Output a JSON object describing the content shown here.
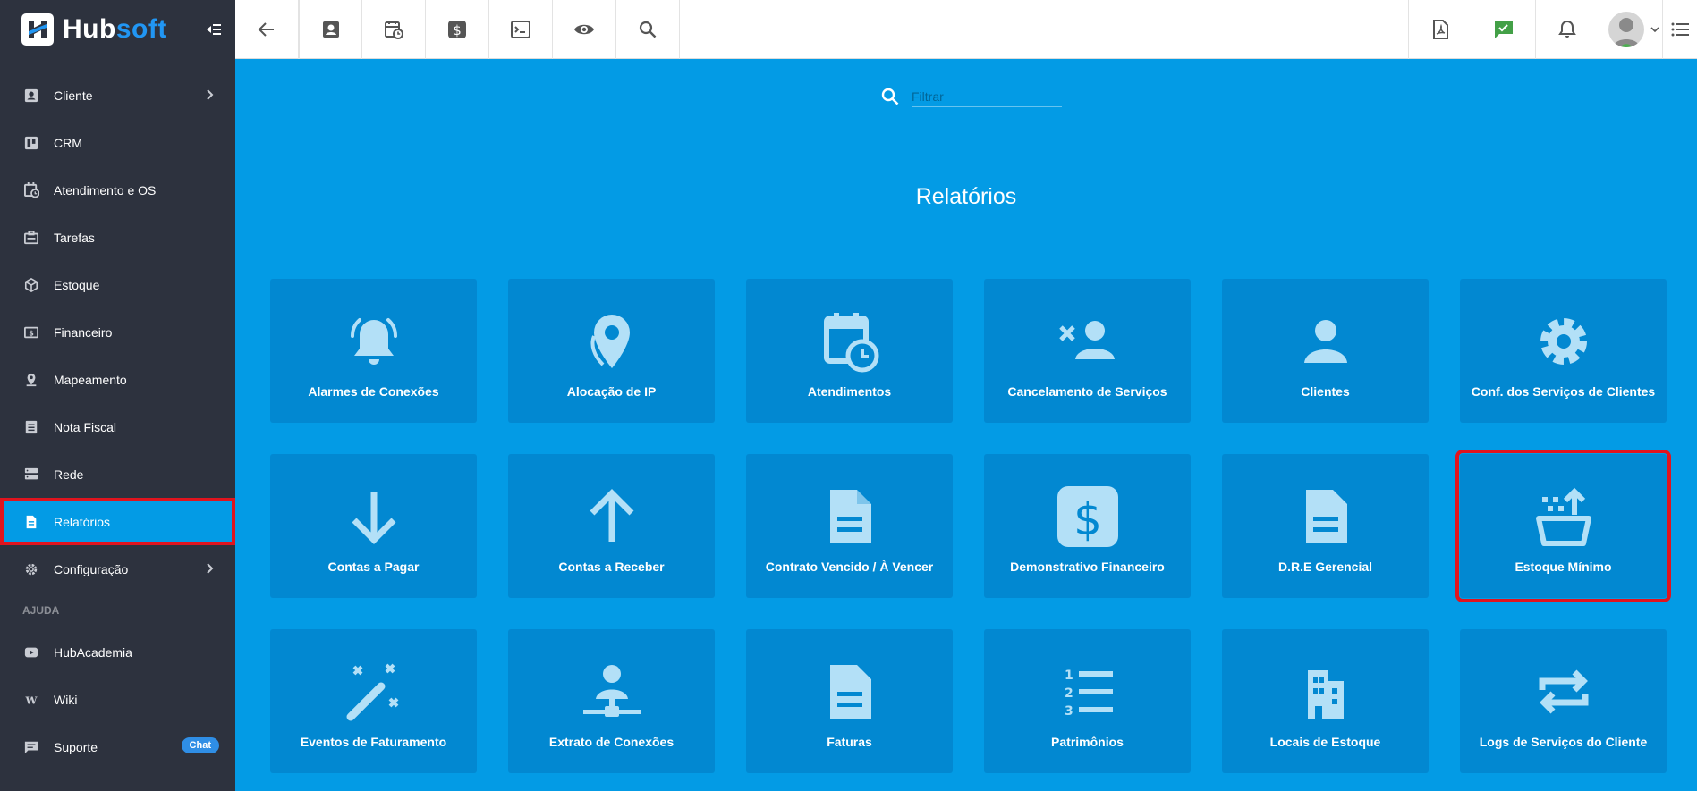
{
  "brand": {
    "name_part1": "Hub",
    "name_part2": "soft"
  },
  "sidebar": {
    "items": [
      {
        "label": "Cliente",
        "icon": "contact-card-icon",
        "has_submenu": true
      },
      {
        "label": "CRM",
        "icon": "kanban-icon",
        "has_submenu": false
      },
      {
        "label": "Atendimento e OS",
        "icon": "calendar-clock-icon",
        "has_submenu": false
      },
      {
        "label": "Tarefas",
        "icon": "tasks-icon",
        "has_submenu": false
      },
      {
        "label": "Estoque",
        "icon": "box-icon",
        "has_submenu": false
      },
      {
        "label": "Financeiro",
        "icon": "money-icon",
        "has_submenu": false
      },
      {
        "label": "Mapeamento",
        "icon": "map-pin-icon",
        "has_submenu": false
      },
      {
        "label": "Nota Fiscal",
        "icon": "receipt-icon",
        "has_submenu": false
      },
      {
        "label": "Rede",
        "icon": "server-icon",
        "has_submenu": false
      },
      {
        "label": "Relatórios",
        "icon": "document-icon",
        "has_submenu": false,
        "active": true
      },
      {
        "label": "Configuração",
        "icon": "gear-icon",
        "has_submenu": true
      }
    ],
    "help_section_label": "AJUDA",
    "help_items": [
      {
        "label": "HubAcademia",
        "icon": "youtube-icon"
      },
      {
        "label": "Wiki",
        "icon": "wikipedia-icon"
      },
      {
        "label": "Suporte",
        "icon": "chat-icon",
        "badge": "Chat"
      }
    ]
  },
  "toolbar": {
    "left_icons": [
      "back-arrow-icon",
      "contact-card-icon",
      "calendar-clock-icon",
      "dollar-icon",
      "terminal-icon",
      "eye-icon",
      "search-icon"
    ],
    "right_icons": [
      "pdf-icon",
      "check-message-icon",
      "bell-icon",
      "avatar",
      "menu-list-icon"
    ],
    "check_color": "#43a047"
  },
  "main": {
    "filter_placeholder": "Filtrar",
    "title": "Relatórios",
    "accent_color": "#039be5",
    "card_color": "#0288d1",
    "highlight_color": "#e0141e",
    "cards": [
      {
        "label": "Alarmes de Conexões",
        "icon": "bell-ringing-icon"
      },
      {
        "label": "Alocação de IP",
        "icon": "map-pin-icon"
      },
      {
        "label": "Atendimentos",
        "icon": "calendar-clock-icon"
      },
      {
        "label": "Cancelamento de Serviços",
        "icon": "person-remove-icon"
      },
      {
        "label": "Clientes",
        "icon": "person-icon"
      },
      {
        "label": "Conf. dos Serviços de Clientes",
        "icon": "gear-icon"
      },
      {
        "label": "Contas a Pagar",
        "icon": "arrow-down-icon"
      },
      {
        "label": "Contas a Receber",
        "icon": "arrow-up-icon"
      },
      {
        "label": "Contrato Vencido / À Vencer",
        "icon": "document-icon"
      },
      {
        "label": "Demonstrativo Financeiro",
        "icon": "dollar-box-icon"
      },
      {
        "label": "D.R.E Gerencial",
        "icon": "document-icon"
      },
      {
        "label": "Estoque Mínimo",
        "icon": "basket-upload-icon",
        "highlighted": true
      },
      {
        "label": "Eventos de Faturamento",
        "icon": "magic-wand-icon"
      },
      {
        "label": "Extrato de Conexões",
        "icon": "network-person-icon"
      },
      {
        "label": "Faturas",
        "icon": "document-icon"
      },
      {
        "label": "Patrimônios",
        "icon": "numbered-list-icon"
      },
      {
        "label": "Locais de Estoque",
        "icon": "building-icon"
      },
      {
        "label": "Logs de Serviços do Cliente",
        "icon": "repeat-icon"
      }
    ]
  }
}
